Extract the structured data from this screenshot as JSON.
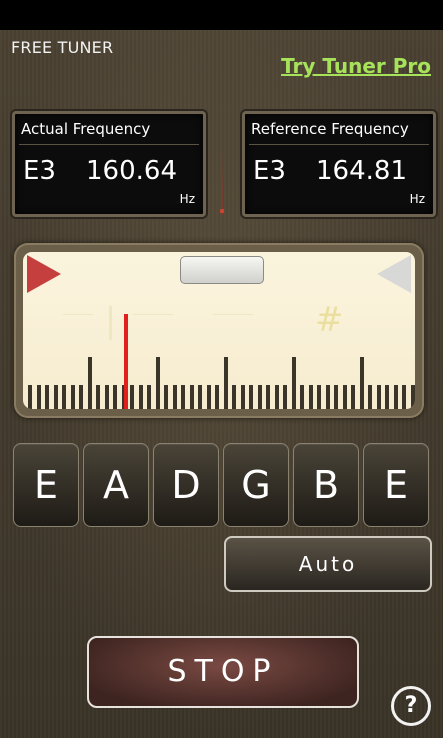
{
  "app": {
    "title": "FREE TUNER",
    "pro_link": "Try Tuner Pro"
  },
  "actual": {
    "label": "Actual Frequency",
    "note": "E3",
    "value": "160.64",
    "unit": "Hz"
  },
  "reference": {
    "label": "Reference Frequency",
    "note": "E3",
    "value": "164.81",
    "unit": "Hz"
  },
  "meter": {
    "sharp_symbol": "#",
    "needle_cents": -25
  },
  "strings": [
    "E",
    "A",
    "D",
    "G",
    "B",
    "E"
  ],
  "buttons": {
    "auto": "Auto",
    "stop": "STOP",
    "help": "?"
  },
  "colors": {
    "accent_link": "#a6e35a",
    "needle": "#e0201c",
    "flat_arrow": "#c53f3f"
  }
}
